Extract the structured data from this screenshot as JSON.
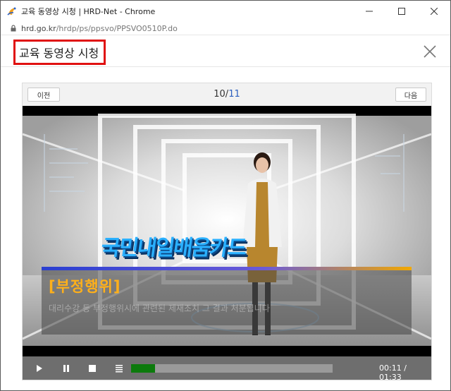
{
  "window": {
    "title": "교육 동영상 시청 | HRD-Net - Chrome",
    "url_host": "hrd.go.kr",
    "url_path": "/hrdp/ps/ppsvo/PPSVO0510P.do"
  },
  "header": {
    "title": "교육 동영상 시청"
  },
  "nav": {
    "prev_label": "이전",
    "next_label": "다음",
    "current_page": "10",
    "separator": "/",
    "total_pages": "11"
  },
  "video": {
    "brand_text": "국민내일배움카드",
    "caption_title": "[부정행위]",
    "caption_sub": "대리수강 등 부정행위시에 관련된 제재조치 그 결과 처분됩니다",
    "progress": 0.12,
    "current_time": "00:11",
    "time_sep": " / ",
    "duration": "01:33"
  },
  "icons": {
    "play": "play-icon",
    "pause": "pause-icon",
    "stop": "stop-icon",
    "menu": "list-icon",
    "close": "close-icon",
    "lock": "lock-icon"
  },
  "colors": {
    "highlight_border": "#e01010",
    "pager_total": "#2c5fbf",
    "caption_title": "#ffb01a",
    "progress_fill": "#0c7a0c"
  }
}
